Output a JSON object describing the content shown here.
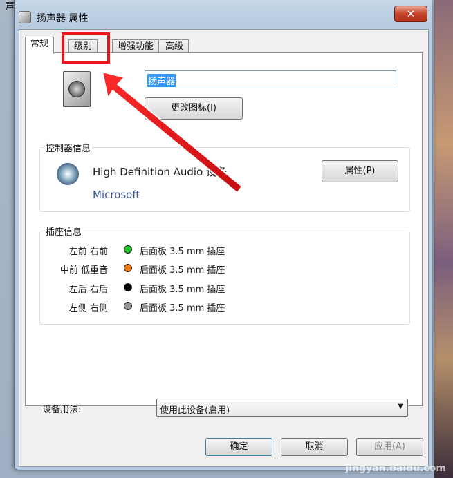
{
  "background": {
    "title": "声音"
  },
  "window": {
    "title": "扬声器 属性",
    "close_label": "✕"
  },
  "tabs": [
    {
      "label": "常规"
    },
    {
      "label": "级别"
    },
    {
      "label": "增强功能"
    },
    {
      "label": "高级"
    }
  ],
  "general": {
    "device_name": "扬声器",
    "change_icon_button": "更改图标(I)"
  },
  "controller": {
    "group_label": "控制器信息",
    "name": "High Definition Audio 设备",
    "vendor": "Microsoft",
    "properties_button": "属性(P)"
  },
  "jacks": {
    "group_label": "插座信息",
    "rows": [
      {
        "label": "左前 右前",
        "desc": "后面板 3.5 mm 插座",
        "color": "#1fbf2a"
      },
      {
        "label": "中前 低重音",
        "desc": "后面板 3.5 mm 插座",
        "color": "#f07a12"
      },
      {
        "label": "左后 右后",
        "desc": "后面板 3.5 mm 插座",
        "color": "#000000"
      },
      {
        "label": "左侧 右侧",
        "desc": "后面板 3.5 mm 插座",
        "color": "#9a9a9a"
      }
    ]
  },
  "usage": {
    "label": "设备用法:",
    "selected": "使用此设备(启用)"
  },
  "footer": {
    "ok": "确定",
    "cancel": "取消",
    "apply": "应用(A)"
  },
  "watermark": "jingyan.baidu.com",
  "colors": {
    "annotation": "#e8161c",
    "title_bar": "#b8cbe0"
  }
}
